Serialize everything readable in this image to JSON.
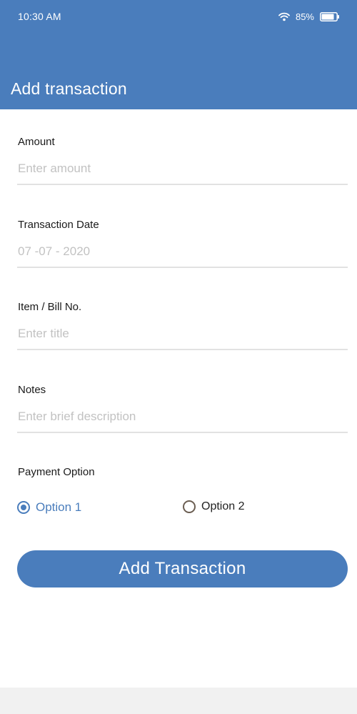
{
  "status_bar": {
    "time": "10:30 AM",
    "battery_percent": "85%",
    "wifi_icon": "wifi-icon",
    "battery_icon": "battery-icon",
    "battery_level": 0.85
  },
  "header": {
    "title": "Add transaction"
  },
  "form": {
    "amount": {
      "label": "Amount",
      "value": "",
      "placeholder": "Enter amount"
    },
    "date": {
      "label": "Transaction Date",
      "value": "",
      "placeholder": "07 -07 - 2020"
    },
    "item": {
      "label": "Item / Bill No.",
      "value": "",
      "placeholder": "Enter title"
    },
    "notes": {
      "label": "Notes",
      "value": "",
      "placeholder": "Enter brief description"
    },
    "payment": {
      "label": "Payment Option",
      "options": [
        {
          "label": "Option 1",
          "selected": true
        },
        {
          "label": "Option 2",
          "selected": false
        }
      ]
    },
    "submit_label": "Add Transaction"
  },
  "colors": {
    "primary": "#4a7dbc",
    "placeholder": "#c2c2c2",
    "divider": "#e2e2e2",
    "bottom_bar": "#f1f1f1"
  }
}
